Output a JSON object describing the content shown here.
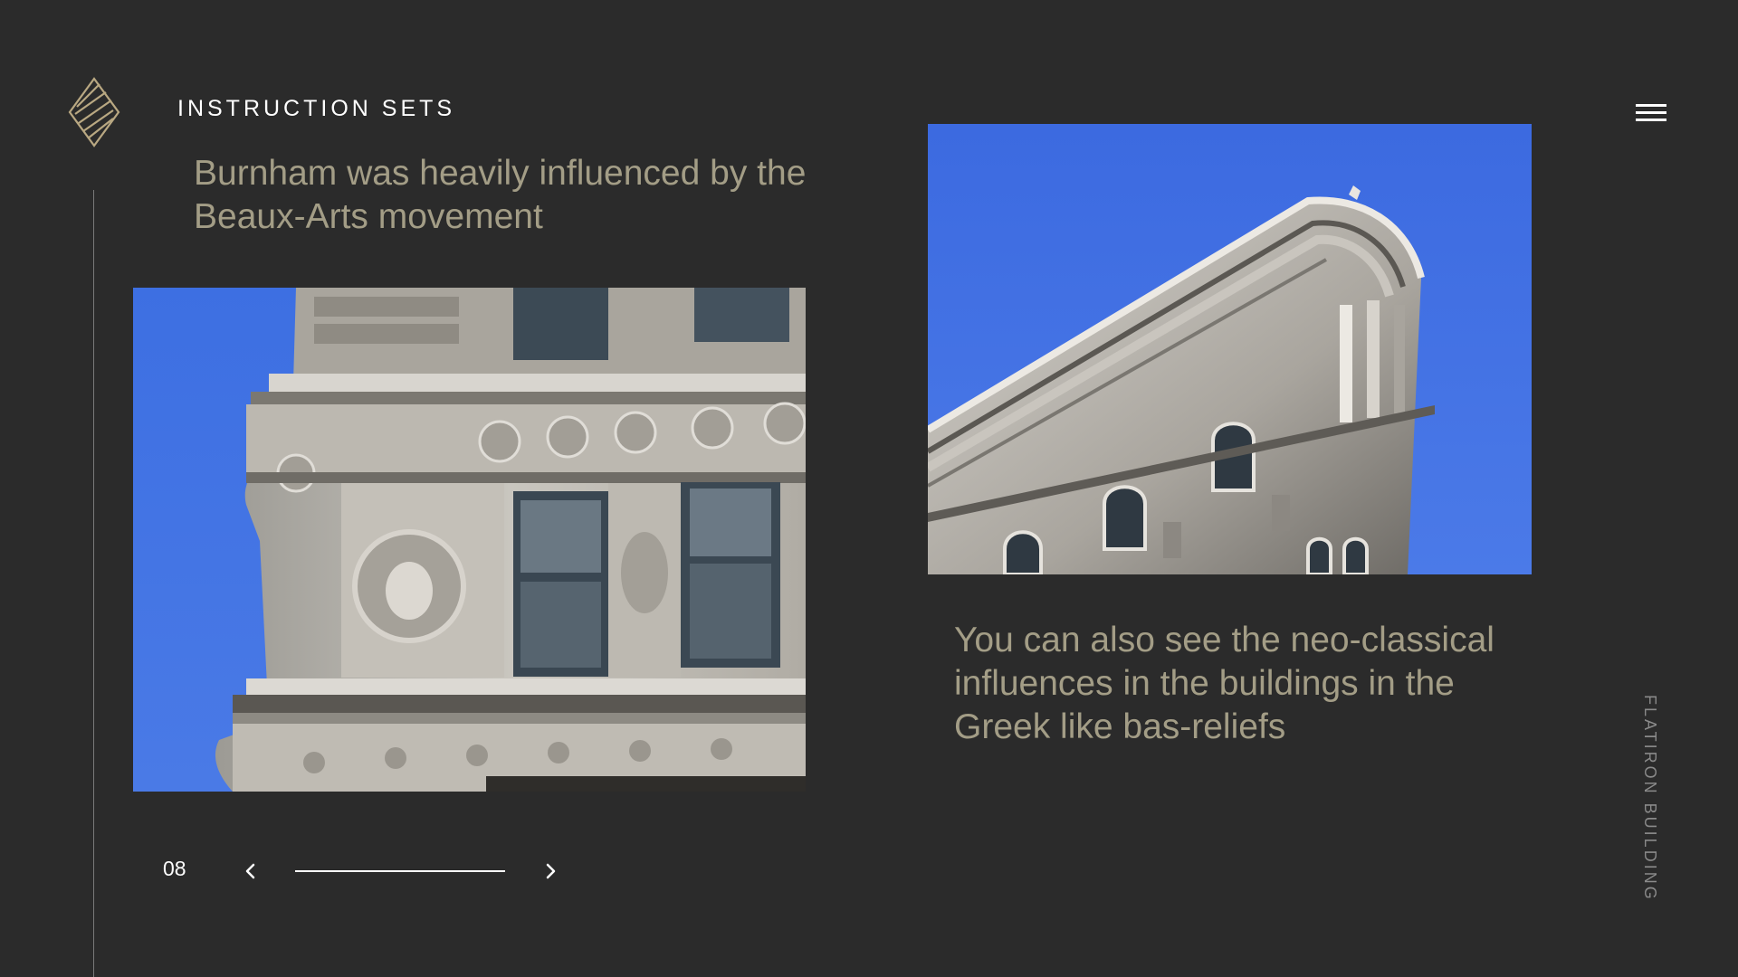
{
  "header": {
    "brand_title": "INSTRUCTION SETS",
    "logo_icon": "layered-diamond-logo",
    "menu_icon": "hamburger-menu-icon"
  },
  "left": {
    "headline": "Burnham was heavily influenced by the Beaux-Arts movement",
    "photo_description": ""
  },
  "right": {
    "caption": "You can also see the neo-classical influences in the buildings in the Greek like bas-reliefs"
  },
  "side_label": "FLATIRON BUILDING",
  "pagination": {
    "page_number": "08",
    "prev_icon": "chevron-left-icon",
    "next_icon": "chevron-right-icon",
    "progress": 1.0
  },
  "colors": {
    "background": "#2b2b2b",
    "text_accent": "#a39d86",
    "logo_gold": "#b9a882",
    "sky_blue": "#3f6fe0"
  }
}
